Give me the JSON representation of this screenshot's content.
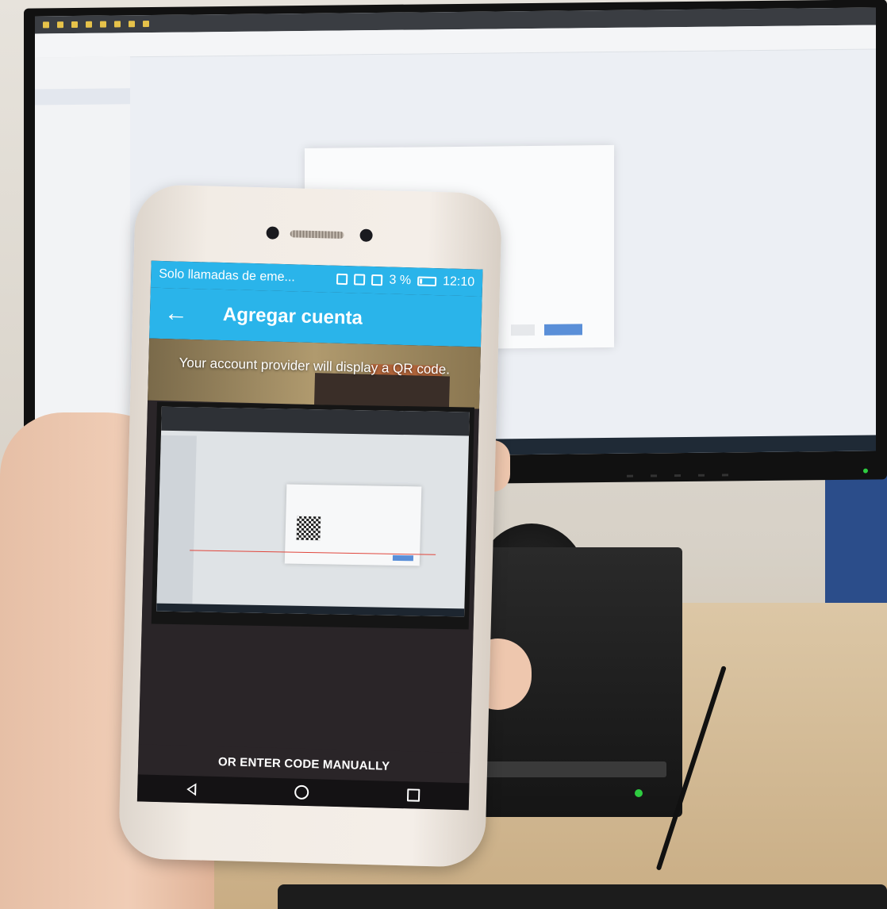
{
  "phone": {
    "status_bar": {
      "notice": "Solo llamadas de eme...",
      "battery_text": "3 %",
      "time": "12:10"
    },
    "app_bar": {
      "back_icon": "arrow-left-icon",
      "title": "Agregar cuenta"
    },
    "camera_view": {
      "hint": "Your account provider will display a QR code."
    },
    "manual_entry": {
      "label": "OR ENTER CODE MANUALLY"
    },
    "nav_bar": {
      "back": "nav-back-icon",
      "home": "nav-home-icon",
      "recents": "nav-recents-icon"
    }
  },
  "colors": {
    "app_accent": "#2ab4ea",
    "scan_line": "#e0463c",
    "dialog_button": "#5a8fd8"
  }
}
